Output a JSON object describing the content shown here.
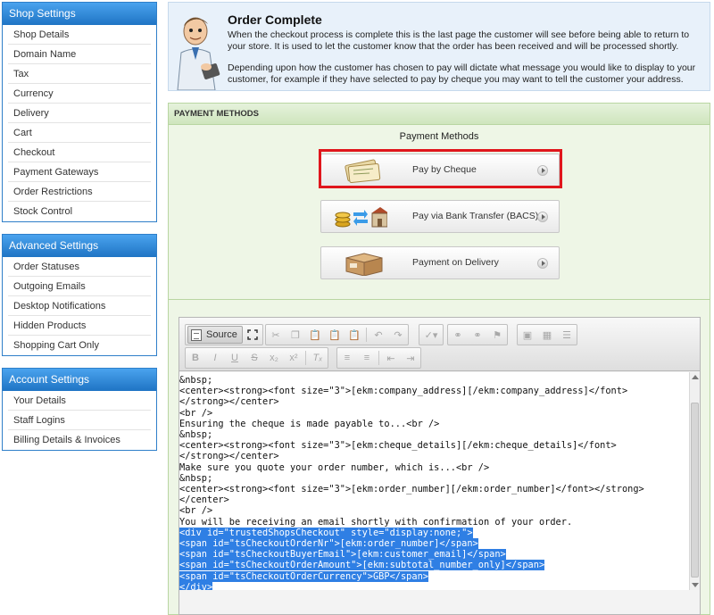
{
  "sidebar": {
    "shop": {
      "title": "Shop Settings",
      "items": [
        "Shop Details",
        "Domain Name",
        "Tax",
        "Currency",
        "Delivery",
        "Cart",
        "Checkout",
        "Payment Gateways",
        "Order Restrictions",
        "Stock Control"
      ]
    },
    "advanced": {
      "title": "Advanced Settings",
      "items": [
        "Order Statuses",
        "Outgoing Emails",
        "Desktop Notifications",
        "Hidden Products",
        "Shopping Cart Only"
      ]
    },
    "account": {
      "title": "Account Settings",
      "items": [
        "Your Details",
        "Staff Logins",
        "Billing Details & Invoices"
      ]
    }
  },
  "banner": {
    "title": "Order Complete",
    "para1": "When the checkout process is complete this is the last page the customer will see before being able to return to your store. It is used to let the customer know that the order has been received and will be processed shortly.",
    "para2": "Depending upon how the customer has chosen to pay will dictate what message you would like to display to your customer, for example if they have selected to pay by cheque you may want to tell the customer your address."
  },
  "payment": {
    "section_header": "PAYMENT METHODS",
    "title": "Payment Methods",
    "methods": [
      {
        "label": "Pay by Cheque",
        "icon": "cheque-icon",
        "selected": true
      },
      {
        "label": "Pay via Bank Transfer (BACS)",
        "icon": "bank-transfer-icon",
        "selected": false
      },
      {
        "label": "Payment on Delivery",
        "icon": "parcel-icon",
        "selected": false
      }
    ],
    "highlight_color": "#e0161c"
  },
  "editor": {
    "source_label": "Source",
    "lines": [
      "&nbsp;",
      "<center><strong><font size=\"3\">[ekm:company_address][/ekm:company_address]</font>",
      "</strong></center>",
      "<br />",
      "Ensuring the cheque is made payable to...<br />",
      "&nbsp;",
      "<center><strong><font size=\"3\">[ekm:cheque_details][/ekm:cheque_details]</font>",
      "</strong></center>",
      "Make sure you quote your order number, which is...<br />",
      "&nbsp;",
      "<center><strong><font size=\"3\">[ekm:order_number][/ekm:order_number]</font></strong>",
      "</center>",
      "<br />",
      "You will be receiving an email shortly with confirmation of your order."
    ],
    "selected_lines": [
      "<div id=\"trustedShopsCheckout\" style=\"display:none;\">",
      "<span id=\"tsCheckoutOrderNr\">[ekm:order_number]</span>",
      "<span id=\"tsCheckoutBuyerEmail\">[ekm:customer_email]</span>",
      "<span id=\"tsCheckoutOrderAmount\">[ekm:subtotal_number_only]</span>",
      "<span id=\"tsCheckoutOrderCurrency\">GBP</span>",
      "</div>"
    ],
    "selection_color": "#2f7fe4"
  }
}
